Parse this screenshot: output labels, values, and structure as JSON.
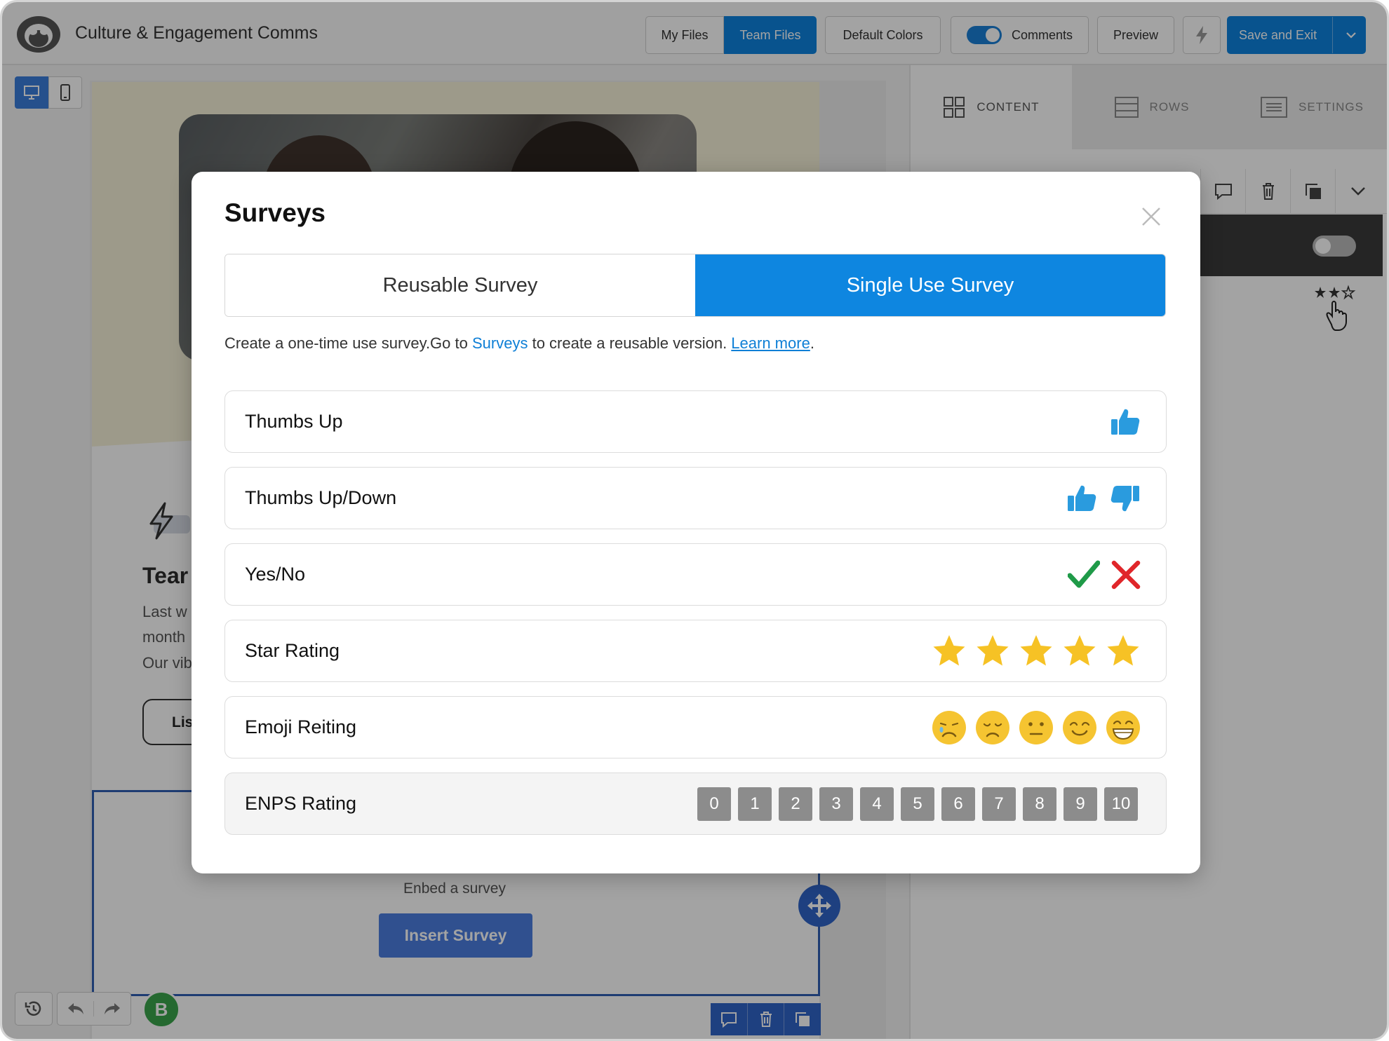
{
  "app": {
    "title": "Culture & Engagement Comms"
  },
  "toolbar": {
    "my_files": "My Files",
    "team_files": "Team Files",
    "default_colors": "Default Colors",
    "comments": "Comments",
    "preview": "Preview",
    "save_exit": "Save and Exit"
  },
  "canvas": {
    "team_heading": "Tear",
    "body_lines": [
      "Last w",
      "month",
      "Our vib"
    ],
    "listen_button": "Lis",
    "embed_text": "Enbed a survey",
    "insert_button": "Insert Survey",
    "avatar_initial": "B"
  },
  "panel": {
    "tabs": [
      "CONTENT",
      "ROWS",
      "SETTINGS"
    ]
  },
  "modal": {
    "title": "Surveys",
    "tabs": {
      "reusable": "Reusable Survey",
      "single": "Single Use Survey",
      "active": "Single Use Survey"
    },
    "desc_prefix": "Create a one-time use survey.Go to ",
    "desc_link": "Surveys",
    "desc_middle": " to create a reusable version. ",
    "desc_learn": "Learn more",
    "desc_end": ".",
    "options": [
      {
        "label": "Thumbs Up",
        "icons": [
          "thumbs-up-icon"
        ]
      },
      {
        "label": "Thumbs Up/Down",
        "icons": [
          "thumbs-up-icon",
          "thumbs-down-icon"
        ]
      },
      {
        "label": "Yes/No",
        "icons": [
          "check-icon",
          "x-icon"
        ]
      },
      {
        "label": "Star Rating",
        "icons": [
          "star-icon",
          "star-icon",
          "star-icon",
          "star-icon",
          "star-icon"
        ]
      },
      {
        "label": "Emoji Reiting",
        "icons": [
          "crying-face-icon",
          "sad-face-icon",
          "neutral-face-icon",
          "smile-face-icon",
          "grin-face-icon"
        ]
      },
      {
        "label": "ENPS Rating",
        "scale": [
          "0",
          "1",
          "2",
          "3",
          "4",
          "5",
          "6",
          "7",
          "8",
          "9",
          "10"
        ]
      }
    ]
  },
  "colors": {
    "accent": "#0E86E0",
    "thumb": "#2A9BDE",
    "check": "#1F9A48",
    "cross": "#E0262A",
    "star": "#F6C225",
    "emoji": "#F5C431",
    "enps_box": "#8C8C8C"
  }
}
